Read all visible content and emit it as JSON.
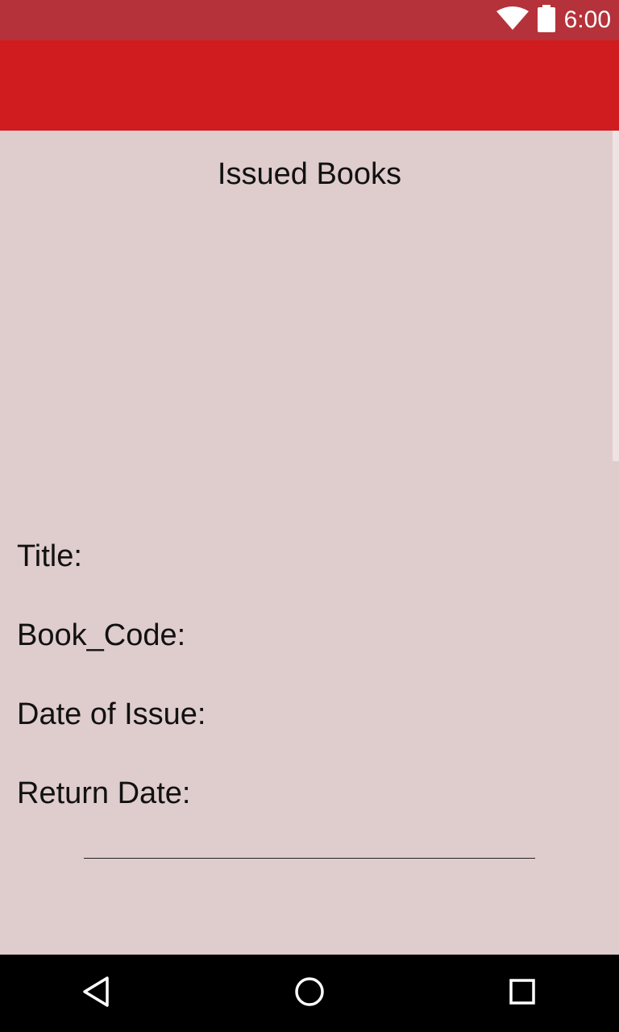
{
  "status_bar": {
    "time": "6:00",
    "icons": [
      "wifi-icon",
      "battery-icon"
    ],
    "background": "#b5323a"
  },
  "app_bar": {
    "background": "#d11c1f"
  },
  "content": {
    "title": "Issued Books",
    "background": "#dfcccc",
    "fields": {
      "title_label": "Title:",
      "book_code_label": "Book_Code:",
      "date_of_issue_label": "Date of Issue:",
      "return_date_label": "Return Date:"
    }
  },
  "nav_bar": {
    "buttons": [
      "back-icon",
      "home-icon",
      "recents-icon"
    ]
  }
}
